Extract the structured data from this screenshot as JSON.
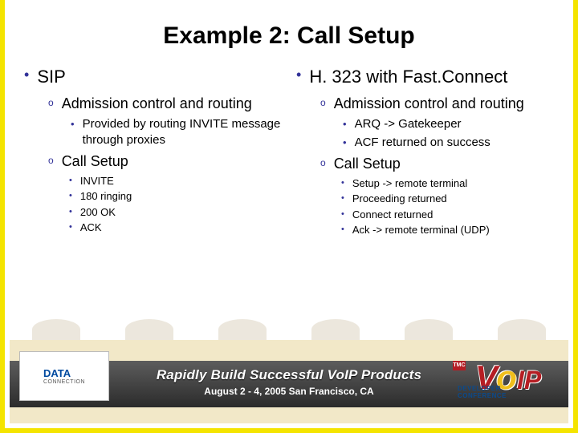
{
  "slide": {
    "title": "Example 2: Call Setup",
    "left": {
      "heading": "SIP",
      "items": [
        {
          "label": "Admission control and routing",
          "children": [
            {
              "label": "Provided by routing INVITE message through proxies"
            }
          ]
        },
        {
          "label": "Call Setup",
          "children": [
            {
              "label": "INVITE"
            },
            {
              "label": "180 ringing"
            },
            {
              "label": "200 OK"
            },
            {
              "label": "ACK"
            }
          ]
        }
      ]
    },
    "right": {
      "heading": "H. 323 with Fast.Connect",
      "items": [
        {
          "label": "Admission control and routing",
          "children": [
            {
              "label": "ARQ -> Gatekeeper"
            },
            {
              "label": "ACF returned on success"
            }
          ]
        },
        {
          "label": "Call Setup",
          "children": [
            {
              "label": "Setup -> remote terminal"
            },
            {
              "label": "Proceeding returned"
            },
            {
              "label": "Connect returned"
            },
            {
              "label": "Ack -> remote terminal (UDP)"
            }
          ]
        }
      ]
    }
  },
  "footer": {
    "title": "Rapidly Build Successful VoIP Products",
    "subtitle": "August 2 - 4, 2005 San Francisco, CA",
    "logoLeft": {
      "name": "DATA",
      "sub": "CONNECTION"
    },
    "logoRight": {
      "brand": "VoIP",
      "caption": "DEVELOPER CONFERENCE",
      "corner": "TMC"
    }
  }
}
